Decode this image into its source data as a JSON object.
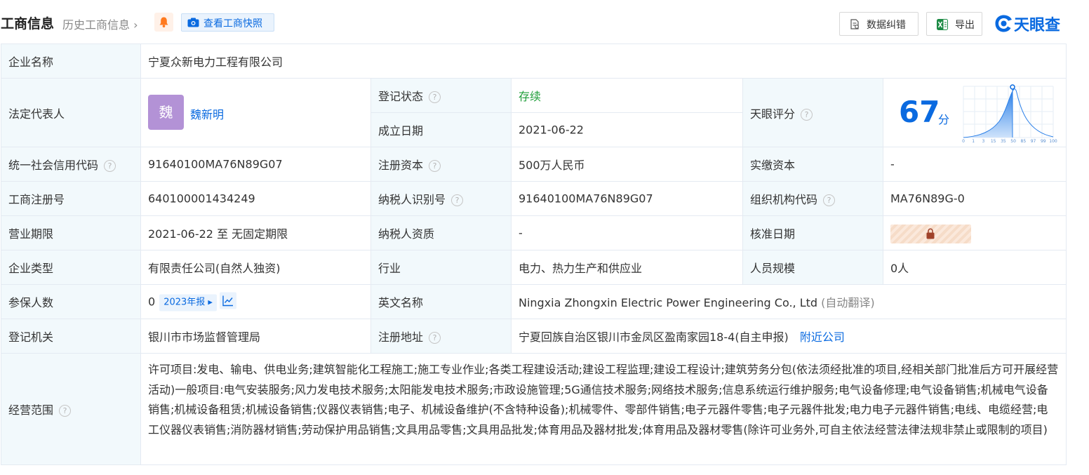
{
  "header": {
    "title": "工商信息",
    "history_link": "历史工商信息",
    "history_chevron": "›",
    "snapshot_button": "查看工商快照",
    "correct_button": "数据纠错",
    "export_button": "导出",
    "logo_text": "天眼查",
    "icons": [
      "bell-icon",
      "camera-icon",
      "document-check-icon",
      "excel-icon",
      "tianyancha-logo-icon"
    ]
  },
  "labels": {
    "company_name": "企业名称",
    "legal_rep": "法定代表人",
    "reg_status": "登记状态",
    "established": "成立日期",
    "tianyan_score": "天眼评分",
    "credit_code": "统一社会信用代码",
    "reg_capital": "注册资本",
    "paid_capital": "实缴资本",
    "biz_reg_no": "工商注册号",
    "taxpayer_id": "纳税人识别号",
    "org_code": "组织机构代码",
    "biz_term": "营业期限",
    "taxpayer_qual": "纳税人资质",
    "approval_date": "核准日期",
    "company_type": "企业类型",
    "industry": "行业",
    "staff_size": "人员规模",
    "insured": "参保人数",
    "english_name": "英文名称",
    "reg_authority": "登记机关",
    "reg_address": "注册地址",
    "business_scope": "经营范围"
  },
  "values": {
    "company_name": "宁夏众新电力工程有限公司",
    "legal_rep_avatar": "魏",
    "legal_rep_name": "魏新明",
    "reg_status": "存续",
    "established": "2021-06-22",
    "score": "67",
    "score_unit": "分",
    "score_ticks": [
      "0",
      "1",
      "3",
      "15",
      "35",
      "50",
      "85",
      "97",
      "99",
      "100"
    ],
    "credit_code": "91640100MA76N89G07",
    "reg_capital": "500万人民币",
    "paid_capital": "-",
    "biz_reg_no": "640100001434249",
    "taxpayer_id": "91640100MA76N89G07",
    "org_code": "MA76N89G-0",
    "biz_term": "2021-06-22 至 无固定期限",
    "taxpayer_qual": "-",
    "company_type": "有限责任公司(自然人独资)",
    "industry": "电力、热力生产和供应业",
    "staff_size": "0人",
    "insured": "0",
    "insured_report": "2023年报",
    "english_name": "Ningxia Zhongxin Electric Power Engineering Co., Ltd",
    "english_name_note": "(自动翻译)",
    "reg_authority": "银川市市场监督管理局",
    "reg_address": "宁夏回族自治区银川市金凤区盈南家园18-4(自主申报)",
    "nearby_link": "附近公司",
    "business_scope": "许可项目:发电、输电、供电业务;建筑智能化工程施工;施工专业作业;各类工程建设活动;建设工程监理;建设工程设计;建筑劳务分包(依法须经批准的项目,经相关部门批准后方可开展经营活动)一般项目:电气安装服务;风力发电技术服务;太阳能发电技术服务;市政设施管理;5G通信技术服务;网络技术服务;信息系统运行维护服务;电气设备修理;电气设备销售;机械电气设备销售;机械设备租赁;机械设备销售;仪器仪表销售;电子、机械设备维护(不含特种设备);机械零件、零部件销售;电子元器件零售;电子元器件批发;电力电子元器件销售;电线、电缆经营;电工仪器仪表销售;消防器材销售;劳动保护用品销售;文具用品零售;文具用品批发;体育用品及器材批发;体育用品及器材零售(除许可业务外,可自主依法经营法律法规非禁止或限制的项目)"
  },
  "help_icon": "?",
  "colors": {
    "label_bg": "#f2f9fc",
    "border": "#e4eaf2",
    "brand_blue": "#0a6ae0",
    "status_green": "#1f9e3a",
    "avatar_purple": "#b392d6"
  }
}
